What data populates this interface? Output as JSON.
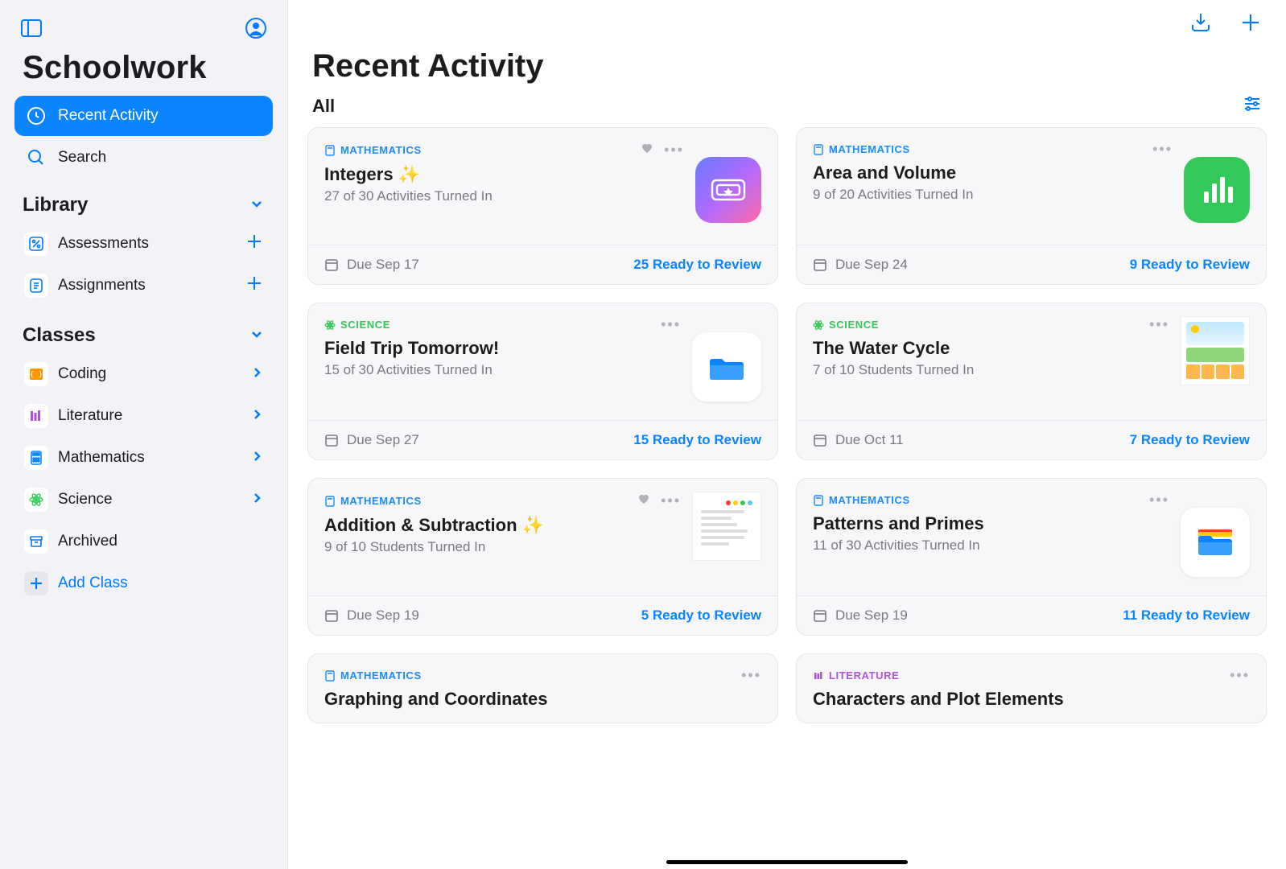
{
  "app": {
    "title": "Schoolwork"
  },
  "nav": {
    "recent": "Recent Activity",
    "search": "Search"
  },
  "library": {
    "header": "Library",
    "assessments": "Assessments",
    "assignments": "Assignments"
  },
  "classes": {
    "header": "Classes",
    "items": [
      {
        "label": "Coding"
      },
      {
        "label": "Literature"
      },
      {
        "label": "Mathematics"
      },
      {
        "label": "Science"
      }
    ],
    "archived": "Archived",
    "add": "Add Class"
  },
  "main": {
    "title": "Recent Activity",
    "filter": "All"
  },
  "subjects": {
    "math": "MATHEMATICS",
    "science": "SCIENCE",
    "literature": "LITERATURE"
  },
  "cards": [
    {
      "subject": "math",
      "title": "Integers ✨",
      "sub": "27 of 30 Activities Turned In",
      "due": "Due Sep 17",
      "ready": "25 Ready to Review",
      "fav": true
    },
    {
      "subject": "math",
      "title": "Area and Volume",
      "sub": "9 of 20 Activities Turned In",
      "due": "Due Sep 24",
      "ready": "9 Ready to Review",
      "fav": false
    },
    {
      "subject": "science",
      "title": "Field Trip Tomorrow!",
      "sub": "15 of 30 Activities Turned In",
      "due": "Due Sep 27",
      "ready": "15 Ready to Review",
      "fav": false
    },
    {
      "subject": "science",
      "title": "The Water Cycle",
      "sub": "7 of 10 Students Turned In",
      "due": "Due Oct 11",
      "ready": "7 Ready to Review",
      "fav": false
    },
    {
      "subject": "math",
      "title": "Addition & Subtraction ✨",
      "sub": "9 of 10 Students Turned In",
      "due": "Due Sep 19",
      "ready": "5 Ready to Review",
      "fav": true
    },
    {
      "subject": "math",
      "title": "Patterns and Primes",
      "sub": "11 of 30 Activities Turned In",
      "due": "Due Sep 19",
      "ready": "11 Ready to Review",
      "fav": false
    },
    {
      "subject": "math",
      "title": "Graphing and Coordinates",
      "sub": "",
      "due": "",
      "ready": "",
      "fav": false
    },
    {
      "subject": "literature",
      "title": "Characters and Plot Elements",
      "sub": "",
      "due": "",
      "ready": "",
      "fav": false
    }
  ]
}
